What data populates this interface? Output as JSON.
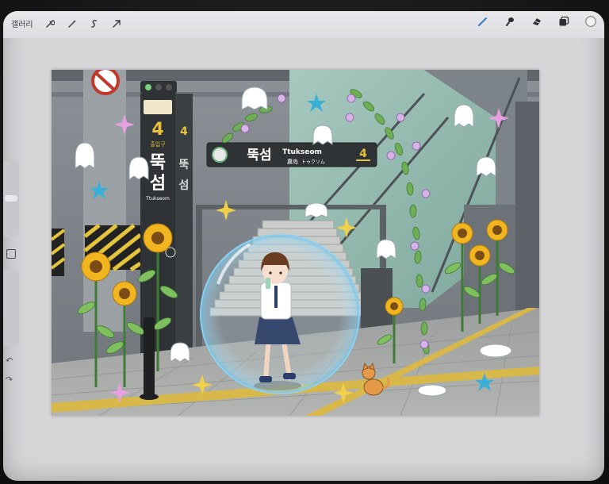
{
  "app": {
    "gallery_label": "갤러리",
    "toolbar_left_icons": [
      "wrench-icon",
      "magic-wand-icon",
      "selection-icon",
      "transform-arrow-icon"
    ],
    "toolbar_right_icons": [
      "brush-icon",
      "smudge-icon",
      "eraser-icon",
      "layers-icon",
      "color-swatch-icon"
    ],
    "brush_active_color": "#3b7fd9",
    "current_color": "#f2f2f2"
  },
  "sidebar": {
    "undo_glyph": "↶",
    "redo_glyph": "↷"
  },
  "artwork": {
    "station_name_ko": "뚝섬",
    "station_name_en": "Ttukseom",
    "station_name_cn": "纛岛",
    "station_name_jp": "トゥクソム",
    "line_number": "4",
    "pillar_name_1": "뚝",
    "pillar_name_2": "섬",
    "pillar_sub": "Ttukseom",
    "pillar_line_num": "4",
    "pillar_line_sub": "출입구",
    "colors": {
      "sky_teal": "#9bbdb4",
      "sign_dark": "#2f3336",
      "sign_yellow": "#e8c23a",
      "bubble": "#8fd0f0",
      "sunflower": "#f0b51f",
      "floor": "#a7aaa8",
      "yellow_line": "#d9b84a"
    }
  }
}
